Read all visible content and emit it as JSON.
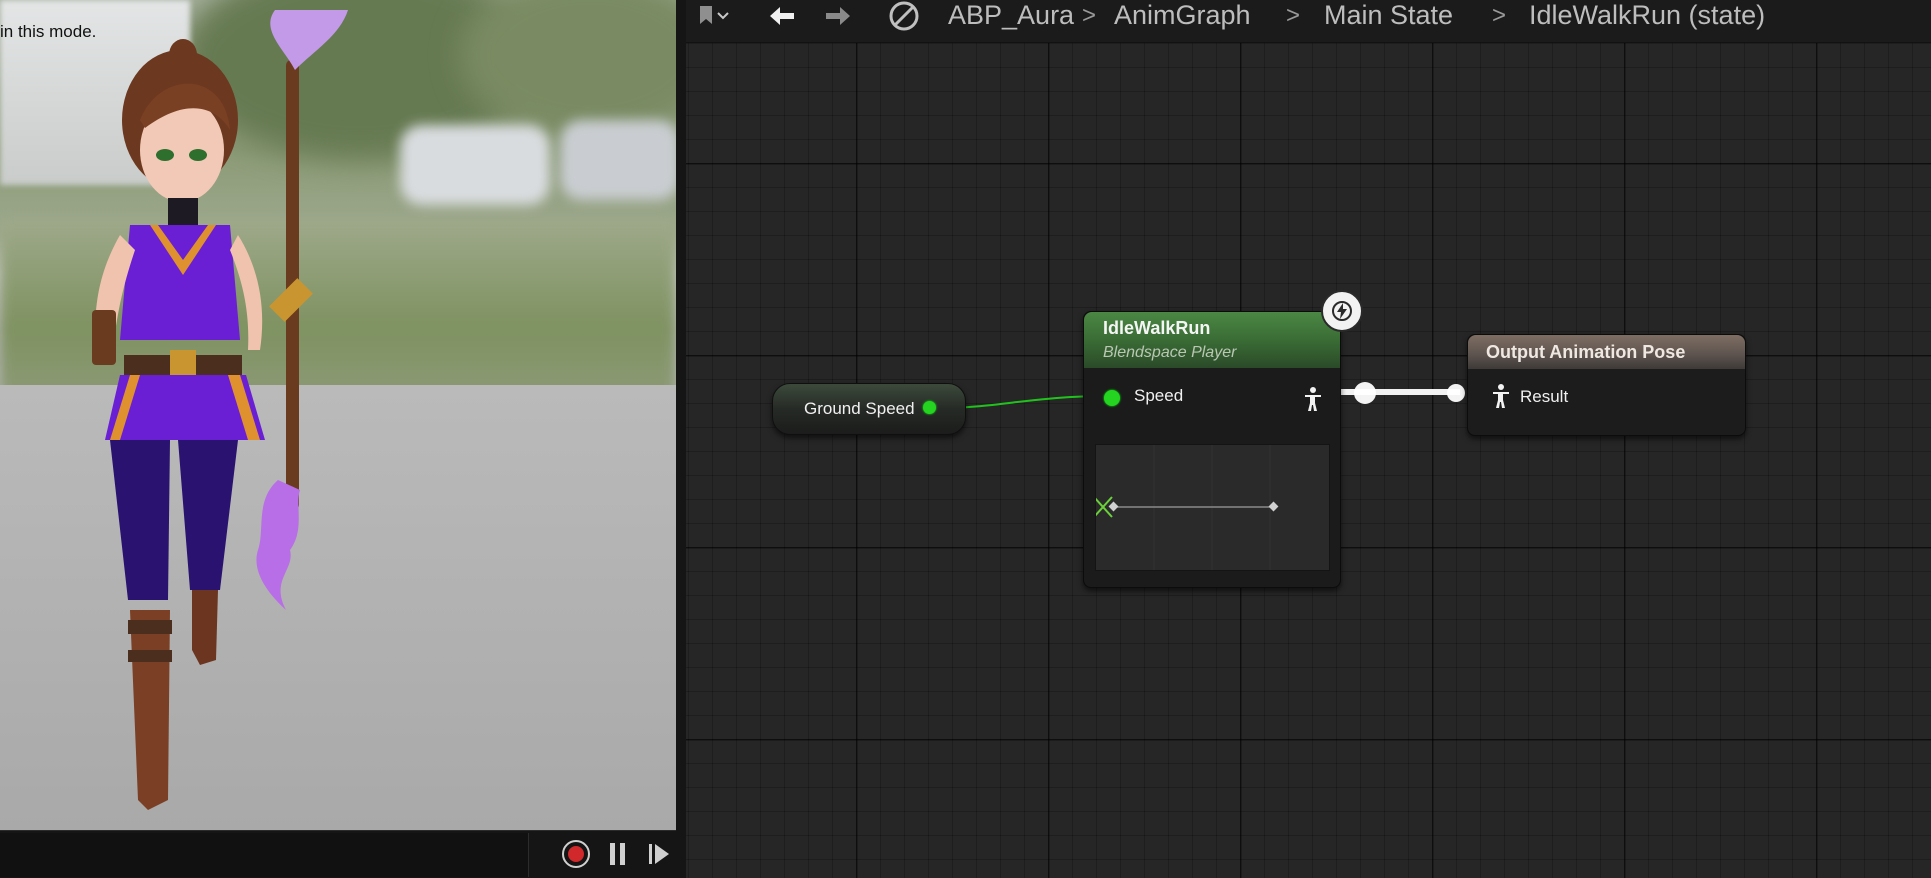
{
  "viewport": {
    "mode_text": "in this mode."
  },
  "toolbar": {
    "bookmark_icon": "bookmark-icon",
    "back_icon": "arrow-left-icon",
    "forward_icon": "arrow-right-icon",
    "blueprint_icon": "no-symbol-icon"
  },
  "breadcrumbs": {
    "items": [
      "ABP_Aura",
      "AnimGraph",
      "Main State",
      "IdleWalkRun (state)"
    ],
    "separator": ">"
  },
  "nodes": {
    "ground_speed": {
      "label": "Ground Speed"
    },
    "blendspace": {
      "title": "IdleWalkRun",
      "subtitle": "Blendspace Player",
      "input_pin": "Speed"
    },
    "output": {
      "title": "Output Animation Pose",
      "input_pin": "Result"
    }
  },
  "colors": {
    "accent_green": "#25d321",
    "blend_header": "#3a6c35",
    "output_header": "#5f5550",
    "record_red": "#d0282b"
  }
}
